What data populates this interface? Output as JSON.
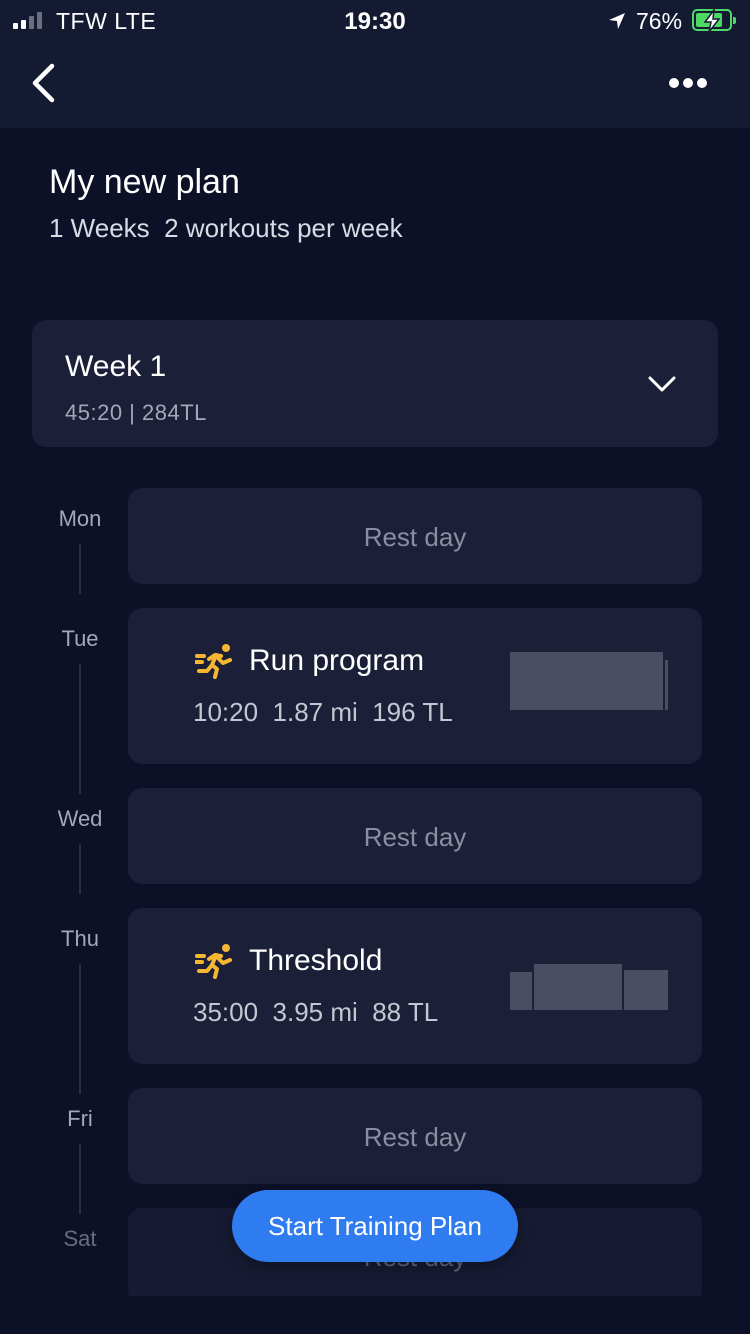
{
  "status_bar": {
    "carrier": "TFW  LTE",
    "time": "19:30",
    "battery_percent": "76%",
    "signal_bars_active": 2,
    "battery_level": 0.76,
    "battery_color": "#4cd964",
    "icons": [
      "signal-bars-icon",
      "location-arrow-icon",
      "battery-charging-icon"
    ]
  },
  "nav": {
    "back_icon": "chevron-left-icon",
    "more_icon": "more-horizontal-icon"
  },
  "plan": {
    "title": "My new plan",
    "subtitle": "1 Weeks  2 workouts per week"
  },
  "week": {
    "title": "Week 1",
    "meta": "45:20 | 284TL",
    "expand_icon": "chevron-down-icon"
  },
  "days": [
    {
      "day": "Mon",
      "type": "rest",
      "label": "Rest day"
    },
    {
      "day": "Tue",
      "type": "workout",
      "title": "Run program",
      "stats": "10:20  1.87 mi  196 TL",
      "icon": "running-person-icon"
    },
    {
      "day": "Wed",
      "type": "rest",
      "label": "Rest day"
    },
    {
      "day": "Thu",
      "type": "workout",
      "title": "Threshold",
      "stats": "35:00  3.95 mi  88 TL",
      "icon": "running-person-icon"
    },
    {
      "day": "Fri",
      "type": "rest",
      "label": "Rest day"
    },
    {
      "day": "Sat",
      "type": "rest",
      "label": "Rest day"
    }
  ],
  "actions": {
    "start_label": "Start Training Plan"
  },
  "colors": {
    "background": "#0d1128",
    "card": "#1b2038",
    "accent": "#2f7bf0",
    "run_icon": "#f5b731"
  }
}
